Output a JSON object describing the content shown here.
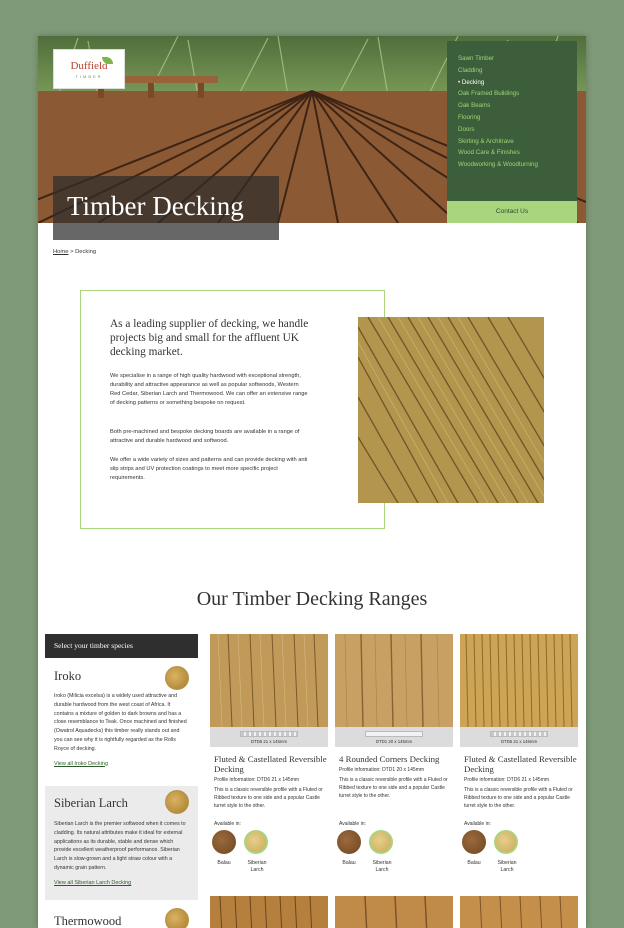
{
  "brand": {
    "name": "Duffield",
    "sub": "TIMBER"
  },
  "hero_title": "Timber Decking",
  "nav": {
    "items": [
      {
        "label": "Sawn Timber",
        "active": false
      },
      {
        "label": "Cladding",
        "active": false
      },
      {
        "label": "Decking",
        "active": true
      },
      {
        "label": "Oak Framed Buildings",
        "active": false
      },
      {
        "label": "Oak Beams",
        "active": false
      },
      {
        "label": "Flooring",
        "active": false
      },
      {
        "label": "Doors",
        "active": false
      },
      {
        "label": "Skirting & Architrave",
        "active": false
      },
      {
        "label": "Wood Care & Finishes",
        "active": false
      },
      {
        "label": "Woodworking & Woodturning",
        "active": false
      }
    ],
    "contact": "Contact Us"
  },
  "breadcrumb": {
    "home": "Home",
    "sep": ">",
    "current": "Decking"
  },
  "intro": {
    "heading": "As a leading supplier of decking, we handle projects big and small for the affluent UK decking market.",
    "p1": "We specialise in a range of high quality hardwood with exceptional strength, durability and attractive appearance as well as popular softwoods, Western Red Cedar, Siberian Larch and Thermowood. We can offer an extensive range of decking patterns or something bespoke on request.",
    "p2": "Both pre-machined and bespoke decking boards are available in a range of attractive and durable hardwood and softwood.",
    "p3": "We offer a wide variety of sizes and patterns and can provide decking with anti slip strips and UV protection coatings to meet more specific project requirements."
  },
  "ranges_title": "Our Timber Decking Ranges",
  "species": {
    "heading": "Select your timber species",
    "items": [
      {
        "name": "Iroko",
        "desc": "Iroko (Milicia excelsa) is a widely used attractive and durable hardwood from the west coast of Africa. It contains a mixture of golden to dark browns and has a close resemblance to Teak. Once machined and finished (Owatrol Aquadecks) this timber really stands out and you can see why it is rightfully regarded as the Rolls Royce of decking.",
        "link": "View all Iroko Decking"
      },
      {
        "name": "Siberian Larch",
        "desc": "Siberian Larch is the premier softwood when it comes to cladding. Its natural attributes make it ideal for external applications as its durable, stable and dense which provide excellent weatherproof performance. Siberian Larch is slow-grown and a light straw colour with a dynamic grain pattern.",
        "link": "View all Siberian Larch Decking"
      },
      {
        "name": "Thermowood"
      }
    ]
  },
  "products": [
    {
      "code": "DTD6 21 x 145mm",
      "title": "Fluted & Castellated Reversible Decking",
      "profile": "Profile information: DTD6 21 x 145mm",
      "desc": "This is a classic reversible profile with a Fluted or Ribbed texture to one side and a popular Castle turret style to the other.",
      "available": "Available in:",
      "woods": [
        "Balau",
        "Siberian Larch"
      ]
    },
    {
      "code": "DTD1 20 x 145mm",
      "title": "4 Rounded Corners Decking",
      "profile": "Profile information: DTD1 20 x 145mm",
      "desc": "This is a classic reversible profile with a Fluted or Ribbed texture to one side and a popular Castle turret style to the other.",
      "available": "Available in:",
      "woods": [
        "Balau",
        "Siberian Larch"
      ]
    },
    {
      "code": "DTD6 21 x 145mm",
      "title": "Fluted & Castellated Reversible Decking",
      "profile": "Profile information: DTD6 21 x 145mm",
      "desc": "This is a classic reversible profile with a Fluted or Ribbed texture to one side and a popular Castle turret style to the other.",
      "available": "Available in:",
      "woods": [
        "Balau",
        "Siberian Larch"
      ]
    }
  ],
  "colors": {
    "nav_bg": "#3c5e3a",
    "nav_text": "#9ed57a",
    "accent": "#a8d57e",
    "dark": "#2f2f2f"
  }
}
